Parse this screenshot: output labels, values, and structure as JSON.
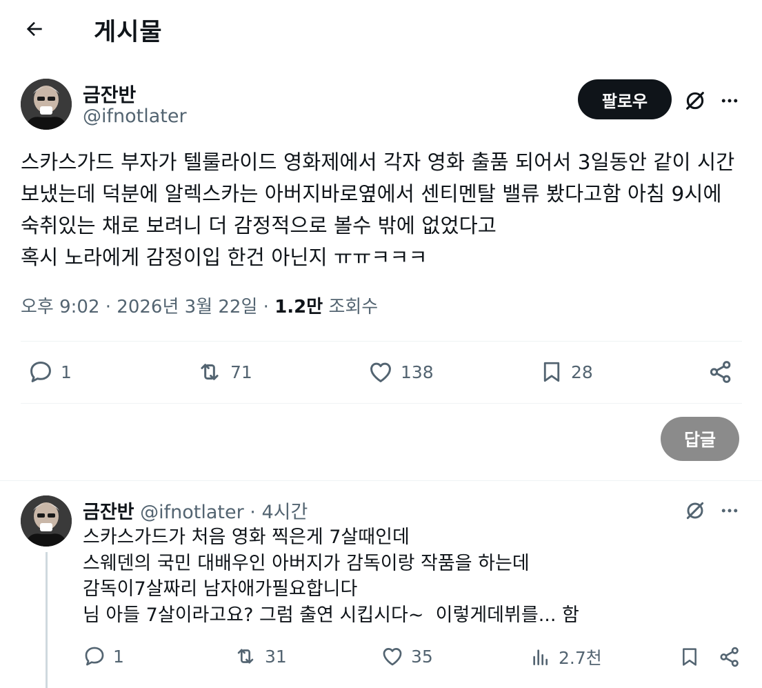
{
  "header": {
    "title": "게시물"
  },
  "post": {
    "author_name": "금잔반",
    "author_handle": "@ifnotlater",
    "follow_label": "팔로우",
    "text": "스카스가드 부자가 텔룰라이드 영화제에서 각자 영화 출품 되어서 3일동안 같이 시간 보냈는데 덕분에 알렉스카는 아버지바로옆에서 센티멘탈 밸류 봤다고함 아침 9시에 숙취있는 채로 보려니 더 감정적으로 볼수 밖에 없었다고\n혹시 노라에게 감정이입 한건 아닌지 ㅠㅠㅋㅋㅋ",
    "time": "오후 9:02",
    "date": "2026년 3월 22일",
    "views_count": "1.2만",
    "views_label": "조회수",
    "replies": "1",
    "reposts": "71",
    "likes": "138",
    "bookmarks": "28"
  },
  "reply_button_label": "답글",
  "reply": {
    "author_name": "금잔반",
    "author_handle": "@ifnotlater",
    "time": "4시간",
    "text": "스카스가드가 처음 영화 찍은게 7살때인데\n스웨덴의 국민 대배우인 아버지가 감독이랑 작품을 하는데\n감독이7살짜리 남자애가필요합니다\n님 아들 7살이라고요? 그럼 출연 시킵시다~  이렇게데뷔를... 함",
    "replies": "1",
    "reposts": "31",
    "likes": "35",
    "views": "2.7천"
  },
  "icons": {
    "back": "arrow-left-icon",
    "grok": "grok-icon",
    "more": "more-icon",
    "reply": "reply-icon",
    "repost": "repost-icon",
    "like": "like-icon",
    "bookmark": "bookmark-icon",
    "share": "share-icon",
    "views": "views-icon"
  }
}
